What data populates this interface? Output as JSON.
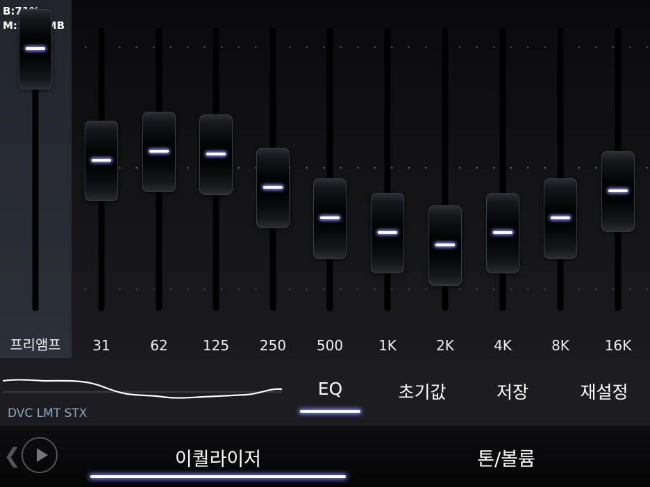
{
  "status": {
    "battery": "B:71%",
    "memory": "M:1100MB"
  },
  "preamp": {
    "label": "프리앰프",
    "level_fraction": 0.97
  },
  "bands": [
    {
      "label": "31",
      "level_fraction": 0.6
    },
    {
      "label": "62",
      "level_fraction": 0.63
    },
    {
      "label": "125",
      "level_fraction": 0.62
    },
    {
      "label": "250",
      "level_fraction": 0.51
    },
    {
      "label": "500",
      "level_fraction": 0.41
    },
    {
      "label": "1K",
      "level_fraction": 0.36
    },
    {
      "label": "2K",
      "level_fraction": 0.32
    },
    {
      "label": "4K",
      "level_fraction": 0.36
    },
    {
      "label": "8K",
      "level_fraction": 0.41
    },
    {
      "label": "16K",
      "level_fraction": 0.5
    }
  ],
  "dsp_status": "DVC LMT STX",
  "mid_tabs": {
    "eq": "EQ",
    "preset": "초기값",
    "save": "저장",
    "reset": "재설정"
  },
  "bottom_tabs": {
    "equalizer": "이퀄라이저",
    "tone_volume": "톤/볼륨"
  },
  "icons": {
    "prev": "chevron-left-icon",
    "play": "play-icon"
  },
  "colors": {
    "accent_glow": "#7c80ff",
    "dsp_text": "#8fa6c8"
  }
}
